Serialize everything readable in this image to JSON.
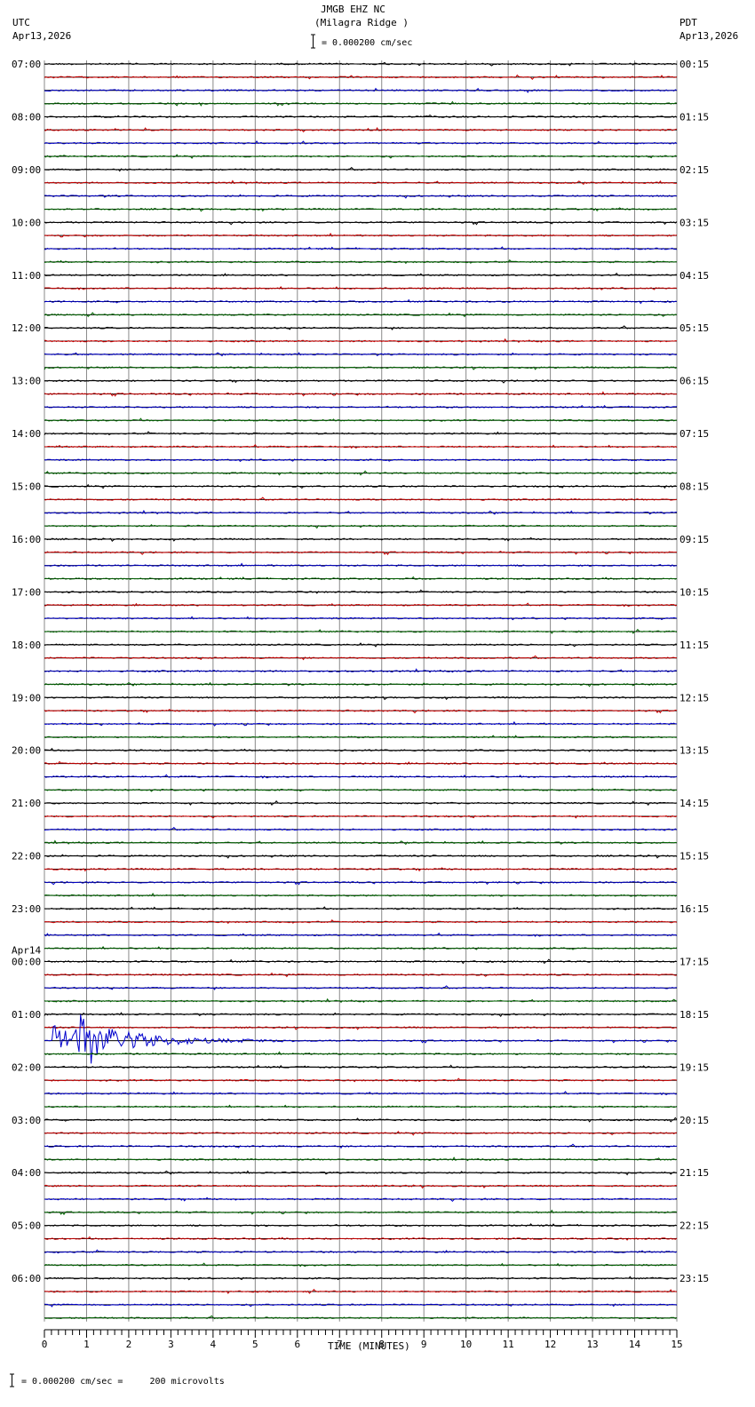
{
  "header": {
    "station": "JMGB EHZ NC",
    "location": "(Milagra Ridge )",
    "scale": "= 0.000200 cm/sec",
    "left_tz": "UTC",
    "left_date": "Apr13,2026",
    "right_tz": "PDT",
    "right_date": "Apr13,2026"
  },
  "footer": {
    "scale_note": "= 0.000200 cm/sec =     200 microvolts"
  },
  "chart_data": {
    "type": "line",
    "title": "JMGB EHZ NC (Milagra Ridge )",
    "xlabel": "TIME (MINUTES)",
    "xlim": [
      0,
      15
    ],
    "x_ticks": [
      "0",
      "1",
      "2",
      "3",
      "4",
      "5",
      "6",
      "7",
      "8",
      "9",
      "10",
      "11",
      "12",
      "13",
      "14",
      "15"
    ],
    "traces_per_hour": 4,
    "trace_colors": [
      "#000000",
      "#cc0000",
      "#0000cc",
      "#006600"
    ],
    "left_labels": [
      "07:00",
      "08:00",
      "09:00",
      "10:00",
      "11:00",
      "12:00",
      "13:00",
      "14:00",
      "15:00",
      "16:00",
      "17:00",
      "18:00",
      "19:00",
      "20:00",
      "21:00",
      "22:00",
      "23:00",
      "00:00",
      "01:00",
      "02:00",
      "03:00",
      "04:00",
      "05:00",
      "06:00"
    ],
    "date_change_label": "Apr14",
    "right_labels": [
      "00:15",
      "01:15",
      "02:15",
      "03:15",
      "04:15",
      "05:15",
      "06:15",
      "07:15",
      "08:15",
      "09:15",
      "10:15",
      "11:15",
      "12:15",
      "13:15",
      "14:15",
      "15:15",
      "16:15",
      "17:15",
      "18:15",
      "19:15",
      "20:15",
      "21:15",
      "22:15",
      "23:15"
    ],
    "events": [
      {
        "utc_trace": "01:30",
        "start_min": 0.2,
        "peak_min": 0.95,
        "end_min": 6.0,
        "color": "#0000cc"
      }
    ]
  }
}
